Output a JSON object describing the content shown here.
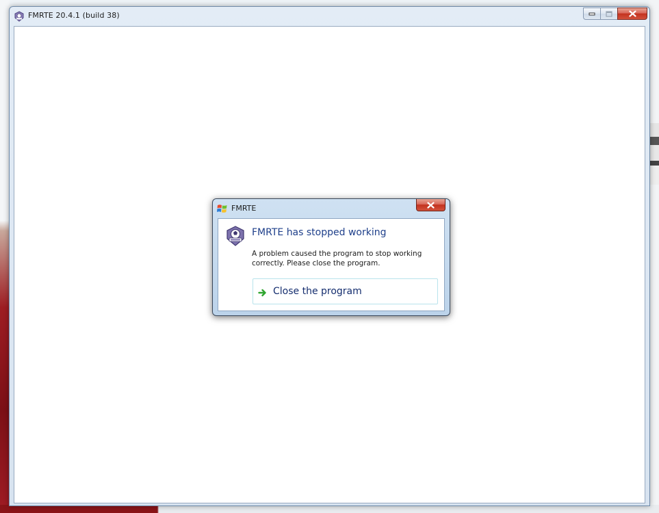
{
  "main_window": {
    "title": "FMRTE 20.4.1 (build 38)"
  },
  "dialog": {
    "title": "FMRTE",
    "heading": "FMRTE has stopped working",
    "message": "A problem caused the program to stop working correctly. Please close the program.",
    "command_label": "Close the program"
  },
  "icons": {
    "app": "fmrte-logo-icon",
    "window_min": "minimize-icon",
    "window_max": "maximize-icon",
    "window_close": "close-icon",
    "dialog_title": "windows-flag-icon",
    "command": "green-arrow-icon"
  },
  "colors": {
    "heading": "#1e3f8a",
    "close_button": "#c3321f",
    "command_arrow": "#2fa52f"
  }
}
